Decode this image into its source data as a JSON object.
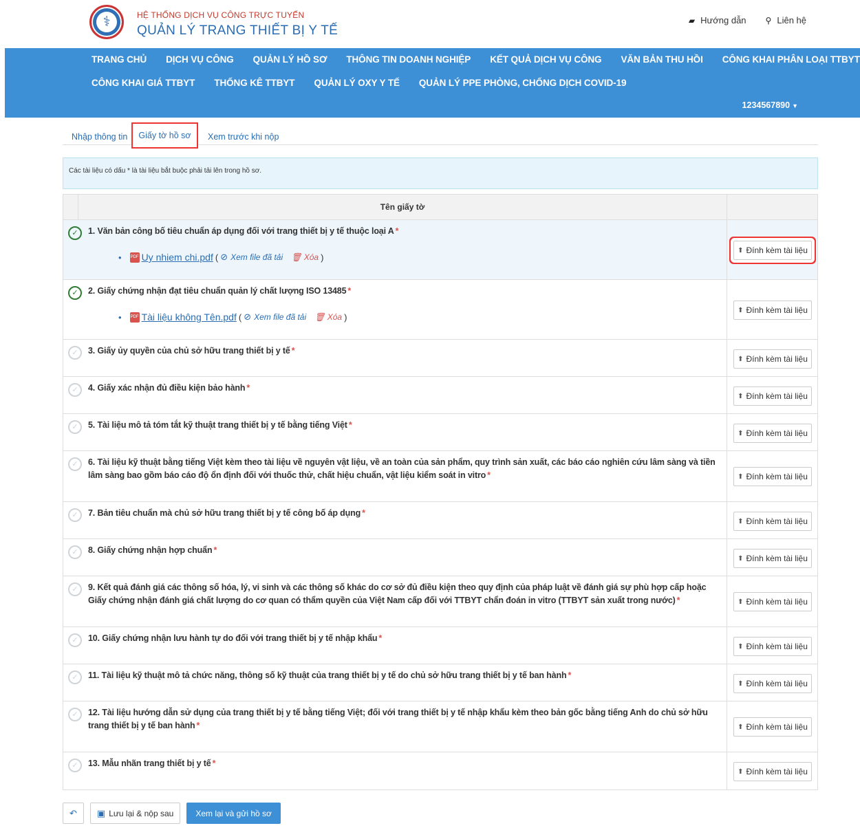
{
  "header": {
    "system_small": "HỆ THỐNG DỊCH VỤ CÔNG TRỰC TUYẾN",
    "system_big": "QUẢN LÝ TRANG THIẾT BỊ Y TẾ",
    "guide": "Hướng dẫn",
    "contact": "Liên hệ"
  },
  "nav": {
    "row1": [
      "TRANG CHỦ",
      "DỊCH VỤ CÔNG",
      "QUẢN LÝ HỒ SƠ",
      "THÔNG TIN DOANH NGHIỆP",
      "KẾT QUẢ DỊCH VỤ CÔNG",
      "VĂN BẢN THU HỒI",
      "CÔNG KHAI PHÂN LOẠI TTBYT"
    ],
    "row2": [
      "CÔNG KHAI GIÁ TTBYT",
      "THỐNG KÊ TTBYT",
      "QUẢN LÝ OXY Y TẾ",
      "QUẢN LÝ PPE PHÒNG, CHỐNG DỊCH COVID-19"
    ],
    "user": "1234567890"
  },
  "tabs": {
    "input": "Nhập thông tin",
    "documents": "Giấy tờ hồ sơ",
    "preview": "Xem trước khi nộp"
  },
  "alert": "Các tài liệu có dấu * là tài liệu bắt buộc phải tải lên trong hồ sơ.",
  "table": {
    "header": "Tên giấy tờ",
    "attach_label": "Đính kèm tài liệu",
    "view_label": "Xem file đã tải",
    "delete_label": "Xóa",
    "rows": [
      {
        "title": "1. Văn bản công bố tiêu chuẩn áp dụng đối với trang thiết bị y tế thuộc loại A",
        "file": "Uy nhiem chi.pdf"
      },
      {
        "title": "2. Giấy chứng nhận đạt tiêu chuẩn quản lý chất lượng ISO 13485",
        "file": "Tài liệu không Tên.pdf"
      },
      {
        "title": "3. Giấy ủy quyền của chủ sở hữu trang thiết bị y tế"
      },
      {
        "title": "4. Giấy xác nhận đủ điều kiện bảo hành"
      },
      {
        "title": "5. Tài liệu mô tả tóm tắt kỹ thuật trang thiết bị y tế bằng tiếng Việt"
      },
      {
        "title": "6. Tài liệu kỹ thuật bằng tiếng Việt kèm theo tài liệu về nguyên vật liệu, về an toàn của sản phẩm, quy trình sản xuất, các báo cáo nghiên cứu lâm sàng và tiền lâm sàng bao gồm báo cáo độ ổn định đối với thuốc thử, chất hiệu chuẩn, vật liệu kiểm soát in vitro"
      },
      {
        "title": "7. Bản tiêu chuẩn mà chủ sở hữu trang thiết bị y tế công bố áp dụng"
      },
      {
        "title": "8. Giấy chứng nhận hợp chuẩn"
      },
      {
        "title": "9. Kết quả đánh giá các thông số hóa, lý, vi sinh và các thông số khác do cơ sở đủ điều kiện theo quy định của pháp luật về đánh giá sự phù hợp cấp hoặc Giấy chứng nhận đánh giá chất lượng do cơ quan có thẩm quyền của Việt Nam cấp đối với TTBYT chẩn đoán in vitro (TTBYT sản xuất trong nước)"
      },
      {
        "title": "10. Giấy chứng nhận lưu hành tự do đối với trang thiết bị y tế nhập khẩu"
      },
      {
        "title": "11. Tài liệu kỹ thuật mô tả chức năng, thông số kỹ thuật của trang thiết bị y tế do chủ sở hữu trang thiết bị y tế ban hành"
      },
      {
        "title": "12. Tài liệu hướng dẫn sử dụng của trang thiết bị y tế bằng tiếng Việt; đối với trang thiết bị y tế nhập khẩu kèm theo bản gốc bằng tiếng Anh do chủ sở hữu trang thiết bị y tế ban hành"
      },
      {
        "title": "13. Mẫu nhãn trang thiết bị y tế"
      }
    ]
  },
  "buttons": {
    "save": "Lưu lại & nộp sau",
    "submit": "Xem lại và gửi hồ sơ"
  },
  "colors": {
    "navbar": "#3d8fd6",
    "link": "#2a6db3",
    "required_star": "#d9534f",
    "check_done": "#2e7d32",
    "highlight_box": "#ee3333"
  }
}
